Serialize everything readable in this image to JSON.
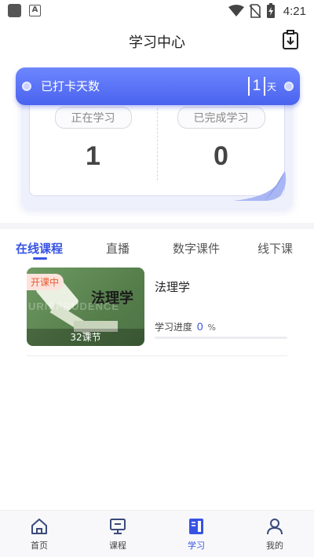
{
  "status_bar": {
    "time": "4:21",
    "icons": [
      "notification-square-icon",
      "app-a-icon",
      "wifi-icon",
      "no-sim-icon",
      "battery-charging-icon"
    ]
  },
  "header": {
    "title": "学习中心",
    "action_icon": "download-icon"
  },
  "checkin": {
    "label": "已打卡天数",
    "days": "1",
    "unit": "天"
  },
  "stats": {
    "studying": {
      "label": "正在学习",
      "value": "1"
    },
    "completed": {
      "label": "已完成学习",
      "value": "0"
    }
  },
  "tabs": [
    {
      "label": "在线课程",
      "active": true
    },
    {
      "label": "直播",
      "active": false
    },
    {
      "label": "数字课件",
      "active": false
    },
    {
      "label": "线下课",
      "active": false
    }
  ],
  "courses": [
    {
      "name": "法理学",
      "badge": "开课中",
      "lessons": "32课节",
      "thumb_title": "法理学",
      "progress_label": "学习进度",
      "progress": 0,
      "progress_unit": "%"
    }
  ],
  "bottom_nav": [
    {
      "label": "首页",
      "icon": "home-icon",
      "active": false
    },
    {
      "label": "课程",
      "icon": "course-monitor-icon",
      "active": false
    },
    {
      "label": "学习",
      "icon": "study-book-icon",
      "active": true
    },
    {
      "label": "我的",
      "icon": "user-icon",
      "active": false
    }
  ],
  "colors": {
    "accent": "#3753e3",
    "banner": "#5b74f6",
    "badge_text": "#e85b33"
  }
}
